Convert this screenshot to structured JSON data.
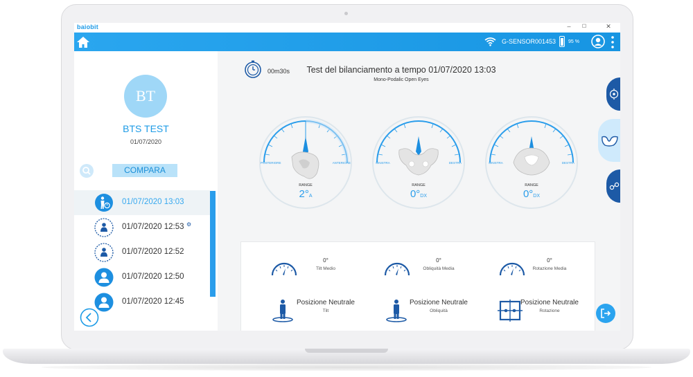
{
  "app": {
    "brand": "baiobit",
    "window_controls": [
      "–",
      "☐",
      "✕"
    ]
  },
  "topbar": {
    "sensor": "G-SENSOR001453",
    "battery": "95 %",
    "battery_level": 0.95
  },
  "sidebar": {
    "avatar_initials": "BT",
    "patient_name": "BTS TEST",
    "patient_date": "01/07/2020",
    "compare_label": "COMPARA",
    "history": [
      {
        "label": "01/07/2020 13:03",
        "active": true,
        "icon": "timer-person-icon"
      },
      {
        "label": "01/07/2020 12:53",
        "active": false,
        "icon": "person-icon",
        "badge": "⚙"
      },
      {
        "label": "01/07/2020 12:52",
        "active": false,
        "icon": "person-icon"
      },
      {
        "label": "01/07/2020 12:50",
        "active": false,
        "icon": "person-filled-icon"
      },
      {
        "label": "01/07/2020 12:45",
        "active": false,
        "icon": "person-filled-icon"
      }
    ]
  },
  "main": {
    "timer": "00m30s",
    "title": "Test del bilanciamento a tempo 01/07/2020 13:03",
    "subtitle": "Mono-Podalic Open Eyes",
    "gauges": [
      {
        "left_label": "POSTERIORE",
        "right_label": "ANTERIORE",
        "range_label": "RANGE",
        "range_value": "2°",
        "range_unit": "A",
        "needle_deg": 0
      },
      {
        "left_label": "SINISTRA",
        "right_label": "DESTRA",
        "range_label": "RANGE",
        "range_value": "0°",
        "range_unit": "DX",
        "needle_deg": 0
      },
      {
        "left_label": "SINISTRA",
        "right_label": "DESTRA",
        "range_label": "RANGE",
        "range_value": "0°",
        "range_unit": "DX",
        "needle_deg": 0
      }
    ],
    "stats": [
      {
        "value": "0°",
        "label": "Tilt Medio"
      },
      {
        "value": "0°",
        "label": "Obliquità Media"
      },
      {
        "value": "0°",
        "label": "Rotazione Media"
      }
    ],
    "neutral": [
      {
        "title": "Posizione Neutrale",
        "sub": "Tilt"
      },
      {
        "title": "Posizione Neutrale",
        "sub": "Obliquità"
      },
      {
        "title": "Posizione Neutrale",
        "sub": "Rotazione"
      }
    ]
  },
  "colors": {
    "accent": "#1d9be6",
    "navy": "#1d5aa6",
    "light_blue": "#b9e2f9"
  }
}
